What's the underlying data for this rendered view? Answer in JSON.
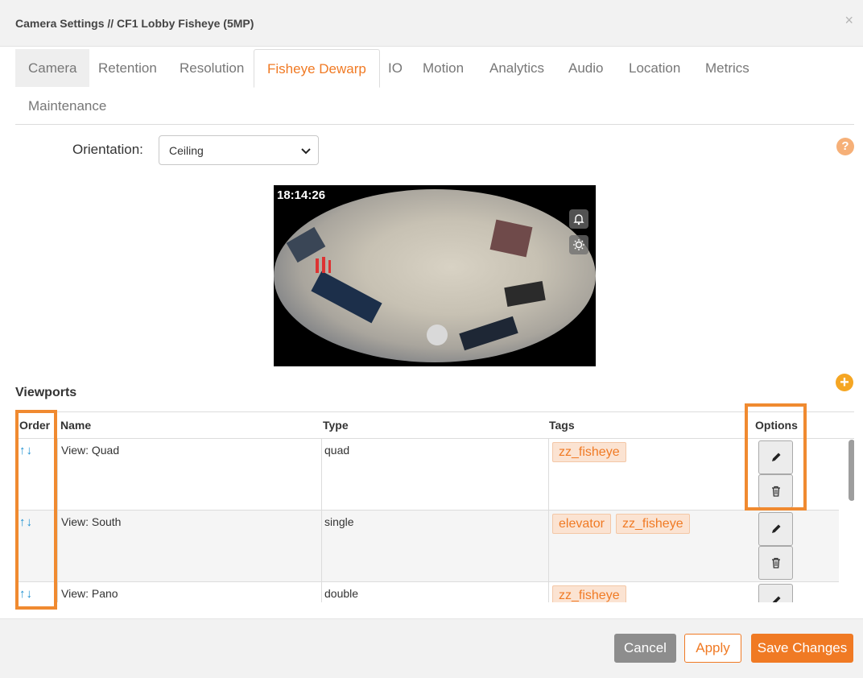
{
  "header": {
    "title": "Camera Settings // CF1 Lobby Fisheye (5MP)",
    "close_label": "×"
  },
  "tabs": [
    {
      "label": "Camera"
    },
    {
      "label": "Retention"
    },
    {
      "label": "Resolution"
    },
    {
      "label": "Fisheye Dewarp",
      "active": true
    },
    {
      "label": "IO"
    },
    {
      "label": "Motion"
    },
    {
      "label": "Analytics"
    },
    {
      "label": "Audio"
    },
    {
      "label": "Location"
    },
    {
      "label": "Metrics"
    },
    {
      "label": "Maintenance"
    }
  ],
  "orientation": {
    "label": "Orientation:",
    "value": "Ceiling"
  },
  "help_label": "?",
  "video": {
    "timestamp": "18:14:26"
  },
  "viewports": {
    "title": "Viewports",
    "add_label": "+",
    "columns": {
      "order": "Order",
      "name": "Name",
      "type": "Type",
      "tags": "Tags",
      "options": "Options"
    },
    "order_arrows": "↑↓",
    "rows": [
      {
        "name": "View: Quad",
        "type": "quad",
        "tags": [
          "zz_fisheye"
        ]
      },
      {
        "name": "View: South",
        "type": "single",
        "tags": [
          "elevator",
          "zz_fisheye"
        ]
      },
      {
        "name": "View: Pano",
        "type": "double",
        "tags": [
          "zz_fisheye"
        ]
      }
    ]
  },
  "footer": {
    "cancel": "Cancel",
    "apply": "Apply",
    "save": "Save Changes"
  },
  "colors": {
    "accent": "#f07a24",
    "highlight": "#f08a30",
    "link_blue": "#1a8fd1"
  }
}
